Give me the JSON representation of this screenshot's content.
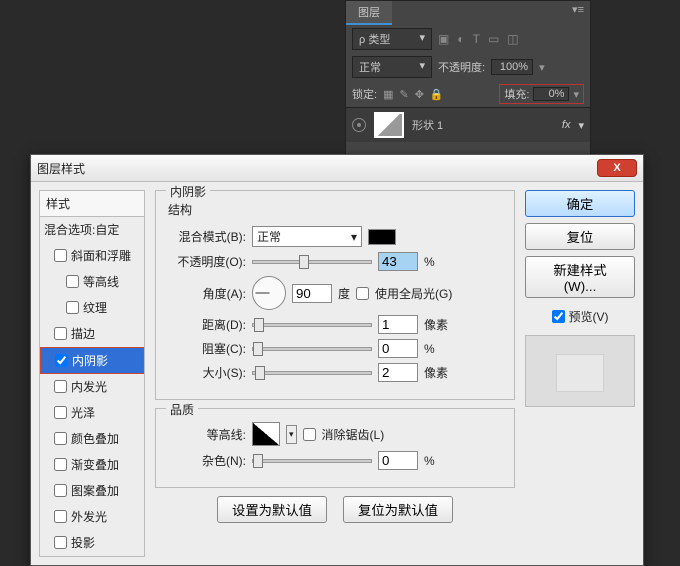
{
  "layers_panel": {
    "tab": "图层",
    "type_filter": "ρ 类型",
    "blend_mode": "正常",
    "opacity_label": "不透明度:",
    "opacity_value": "100%",
    "lock_label": "锁定:",
    "fill_label": "填充:",
    "fill_value": "0%",
    "layer_name": "形状 1",
    "fx": "fx"
  },
  "dialog": {
    "title": "图层样式",
    "close": "X",
    "styles_header": "样式",
    "blend_options": "混合选项:自定",
    "style_list": [
      "斜面和浮雕",
      "等高线",
      "纹理",
      "描边",
      "内阴影",
      "内发光",
      "光泽",
      "颜色叠加",
      "渐变叠加",
      "图案叠加",
      "外发光",
      "投影"
    ],
    "selected_style": "内阴影",
    "inner_shadow": {
      "title": "内阴影",
      "section_structure": "结构",
      "blend_mode_label": "混合模式(B):",
      "blend_mode_value": "正常",
      "opacity_label": "不透明度(O):",
      "opacity_value": "43",
      "opacity_unit": "%",
      "angle_label": "角度(A):",
      "angle_value": "90",
      "angle_unit": "度",
      "global_light": "使用全局光(G)",
      "distance_label": "距离(D):",
      "distance_value": "1",
      "distance_unit": "像素",
      "choke_label": "阻塞(C):",
      "choke_value": "0",
      "choke_unit": "%",
      "size_label": "大小(S):",
      "size_value": "2",
      "size_unit": "像素",
      "section_quality": "品质",
      "contour_label": "等高线:",
      "antialias": "消除锯齿(L)",
      "noise_label": "杂色(N):",
      "noise_value": "0",
      "noise_unit": "%",
      "make_default": "设置为默认值",
      "reset_default": "复位为默认值"
    },
    "buttons": {
      "ok": "确定",
      "cancel": "复位",
      "new_style": "新建样式(W)...",
      "preview": "预览(V)"
    }
  }
}
